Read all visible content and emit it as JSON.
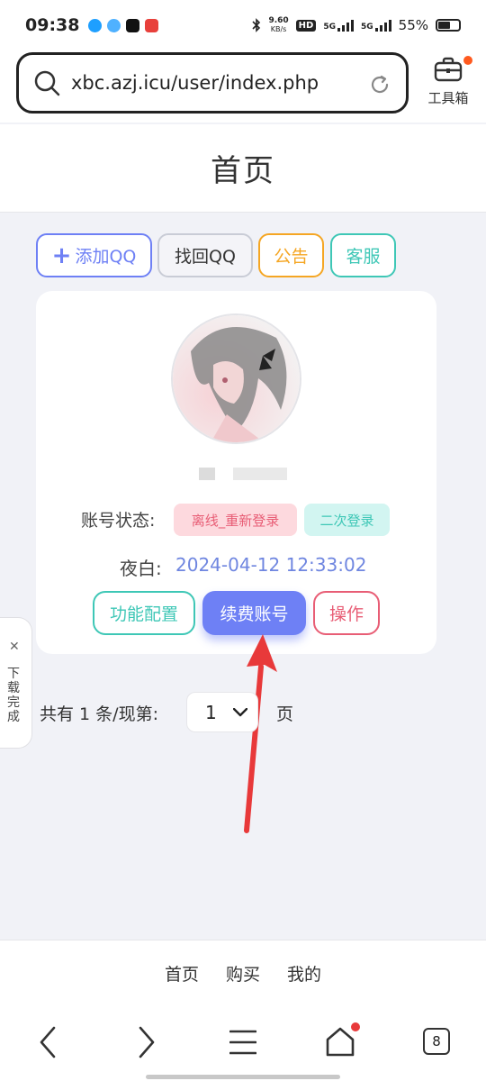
{
  "status_bar": {
    "time": "09:38",
    "net_speed_top": "9.60",
    "net_speed_unit": "KB/s",
    "hd": "HD",
    "sim1": "5G",
    "sim2": "5G",
    "battery": "55%",
    "app_colors": [
      "#1e9fff",
      "#4fb1ff",
      "#111111",
      "#e8403b"
    ]
  },
  "address_bar": {
    "url": "xbc.azj.icu/user/index.php",
    "toolbox_label": "工具箱"
  },
  "page": {
    "title": "首页"
  },
  "tags": {
    "add_qq": "添加QQ",
    "find_qq": "找回QQ",
    "notice": "公告",
    "service": "客服"
  },
  "account_card": {
    "status_label": "账号状态:",
    "status_badge_offline": "离线_重新登录",
    "status_badge_second": "二次登录",
    "name_label": "夜白:",
    "timestamp": "2024-04-12 12:33:02",
    "btn_config": "功能配置",
    "btn_renew": "续费账号",
    "btn_operate": "操作"
  },
  "pagination": {
    "label": "共有 1 条/现第:",
    "current_page": "1",
    "suffix": "页"
  },
  "download_tab": {
    "text": "下载完成"
  },
  "bottom_nav": {
    "home": "首页",
    "buy": "购买",
    "mine": "我的"
  },
  "browser_nav": {
    "tab_count": "8"
  },
  "colors": {
    "primary": "#6e80f5",
    "teal": "#3ec7b6",
    "orange": "#f5a623",
    "pink": "#e85d75",
    "arrow": "#e8393a"
  }
}
